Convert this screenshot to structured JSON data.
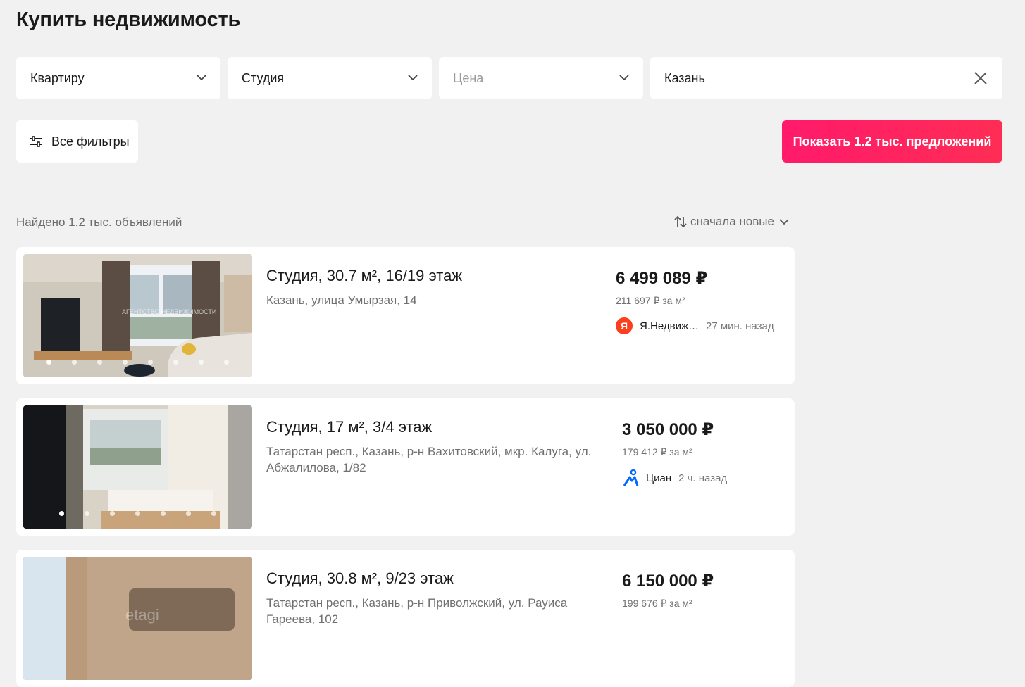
{
  "page": {
    "title": "Купить недвижимость"
  },
  "filters": {
    "type": "Квартиру",
    "rooms": "Студия",
    "price_placeholder": "Цена",
    "city": "Казань",
    "all_filters_label": "Все фильтры",
    "show_button_label": "Показать 1.2 тыс. предложений"
  },
  "results": {
    "found_label": "Найдено 1.2 тыс. объявлений",
    "sort_label": "сначала новые"
  },
  "colors": {
    "accent": "#ff1a6b",
    "background": "#f1f1f1",
    "yandex": "#fc3f1d",
    "cian": "#0468ff"
  },
  "listings": [
    {
      "title": "Студия, 30.7 м², 16/19 этаж",
      "address": "Казань, улица Умырзая, 14",
      "price": "6 499 089 ₽",
      "price_per_m2": "211 697 ₽ за м²",
      "source": "Я.Недвиж…",
      "source_icon": "yandex-logo",
      "posted": "27 мин. назад",
      "photo_count": 8,
      "active_photo": 0,
      "photo_watermark": "АГЕНТСТВО НЕДВИЖИМОСТИ"
    },
    {
      "title": "Студия, 17 м², 3/4 этаж",
      "address": "Татарстан респ., Казань, р-н Вахитовский, мкр. Калуга, ул. Абжалилова, 1/82",
      "price": "3 050 000 ₽",
      "price_per_m2": "179 412 ₽ за м²",
      "source": "Циан",
      "source_icon": "cian-logo",
      "posted": "2 ч. назад",
      "photo_count": 7,
      "active_photo": 0
    },
    {
      "title": "Студия, 30.8 м², 9/23 этаж",
      "address": "Татарстан респ., Казань, р-н Приволжский, ул. Рауиса Гареева, 102",
      "price": "6 150 000 ₽",
      "price_per_m2": "199 676 ₽ за м²",
      "photo_watermark": "etagi"
    }
  ]
}
